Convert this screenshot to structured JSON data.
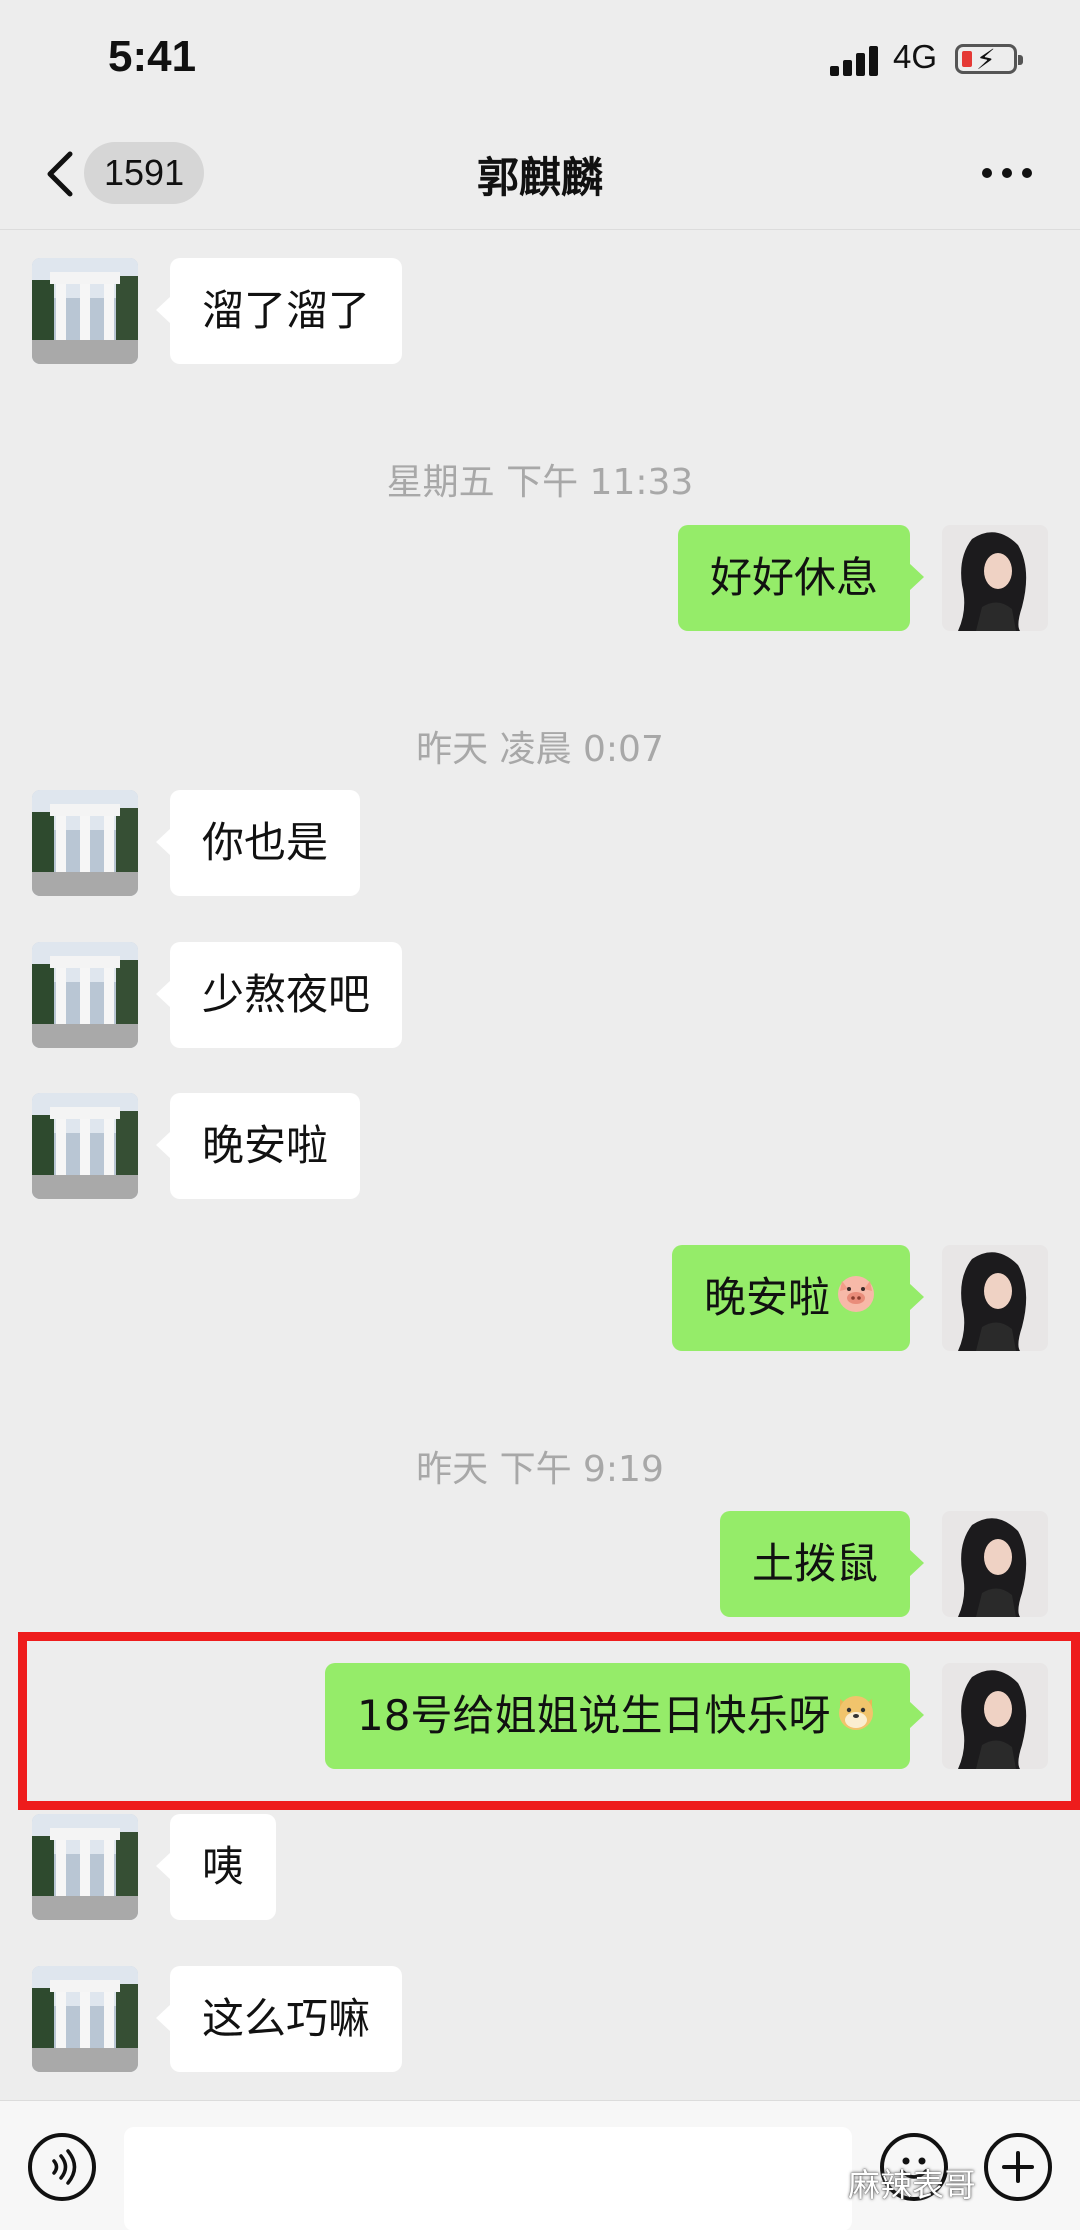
{
  "status": {
    "time": "5:41",
    "network": "4G"
  },
  "nav": {
    "unread": "1591",
    "title": "郭麒麟"
  },
  "messages": [
    {
      "type": "in",
      "text": "溜了溜了"
    },
    {
      "type": "time",
      "text": "星期五 下午 11:33"
    },
    {
      "type": "out",
      "text": "好好休息"
    },
    {
      "type": "time",
      "text": "昨天 凌晨 0:07"
    },
    {
      "type": "in",
      "text": "你也是"
    },
    {
      "type": "in",
      "text": "少熬夜吧"
    },
    {
      "type": "in",
      "text": "晚安啦"
    },
    {
      "type": "out",
      "text": "晚安啦",
      "emoji": "pig-face-emoji"
    },
    {
      "type": "time",
      "text": "昨天 下午 9:19"
    },
    {
      "type": "out",
      "text": "土拨鼠"
    },
    {
      "type": "out",
      "text": "18号给姐姐说生日快乐呀",
      "emoji": "doge-emoji",
      "highlighted": true
    },
    {
      "type": "in",
      "text": "咦"
    },
    {
      "type": "in",
      "text": "这么巧嘛"
    }
  ],
  "highlight_color": "#ee1c1c",
  "bubble_colors": {
    "incoming": "#ffffff",
    "outgoing": "#95ec69"
  },
  "watermark": "麻辣表哥"
}
